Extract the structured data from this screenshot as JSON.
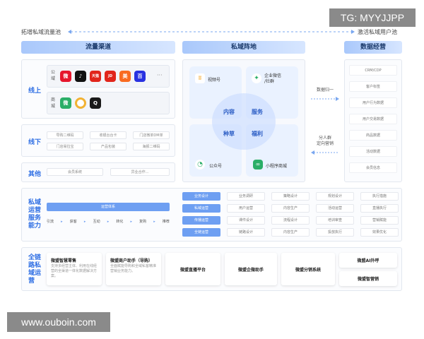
{
  "watermarks": {
    "top": "TG: MYYJJPP",
    "bottom": "www.ouboin.com"
  },
  "top_axis": {
    "left": "拓增私域流量池",
    "right": "激活私域用户池"
  },
  "headers": {
    "channels": "流量渠道",
    "private_domain": "私域阵地",
    "operations": "数据经营"
  },
  "online": {
    "label": "线上",
    "public_domain_label": [
      "公",
      "域"
    ],
    "mall_label": [
      "商",
      "城"
    ],
    "public_apps": [
      {
        "name": "weibo-icon",
        "glyph": "微",
        "color": "#e6162d"
      },
      {
        "name": "douyin-icon",
        "glyph": "♪",
        "color": "#111111"
      },
      {
        "name": "tmall-icon",
        "glyph": "天猫",
        "color": "#e1251b"
      },
      {
        "name": "jd-icon",
        "glyph": "JD",
        "color": "#e1251b"
      },
      {
        "name": "meituan-icon",
        "glyph": "美",
        "color": "#f96b21"
      },
      {
        "name": "baidu-icon",
        "glyph": "百",
        "color": "#2932e1"
      }
    ],
    "more": "···",
    "mall_apps": [
      {
        "name": "wechat-icon",
        "glyph": "微",
        "color": "#2aae67"
      },
      {
        "name": "miniprogram-ring-icon",
        "glyph": "",
        "color": "#f2b233"
      },
      {
        "name": "qq-icon",
        "glyph": "Q",
        "color": "#1a1a1a"
      }
    ]
  },
  "offline": {
    "label": "线下",
    "items": [
      "导购二维码",
      "收银台台卡",
      "门店微单DM单",
      "门店易拉宝",
      "产品包装",
      "海报二维码"
    ]
  },
  "other": {
    "label": "其他",
    "items": [
      "会员系统",
      "异业合作..."
    ]
  },
  "private_domain": {
    "quads": [
      {
        "label": "视频号",
        "icon": "video-channel-icon",
        "color": "#f5a623"
      },
      {
        "label": "企业微信\n/社群",
        "icon": "wecom-icon",
        "color": "#2aae67"
      },
      {
        "label": "公众号",
        "icon": "official-account-icon",
        "color": "#2aae67"
      },
      {
        "label": "小程序商城",
        "icon": "mini-program-icon",
        "color": "#2aae67"
      }
    ],
    "center_words": [
      "内容",
      "服务",
      "种草",
      "福利"
    ]
  },
  "arrows": {
    "data_unify": "数据归一",
    "segmentation": "分人群\n定向营销"
  },
  "data_ops": {
    "items": [
      "CRM/CDP",
      "客户标签",
      "用户行为数据",
      "用户交易数据",
      "商品数据",
      "活动数据",
      "会员信息"
    ]
  },
  "operations": {
    "label": "私域\n运营\n服务\n能力",
    "system": "运营体系",
    "flow": [
      "引流",
      "获客",
      "互动",
      "转化",
      "复购",
      "推荐"
    ],
    "grid": [
      [
        "业务设计",
        "业务调研",
        "策略设计",
        "规划设计",
        "执行措施"
      ],
      [
        "私域运营",
        "用户运营",
        "内容生产",
        "活动运营",
        "直播执行"
      ],
      [
        "传播运营",
        "课件设计",
        "流程设计",
        "培训审查",
        "营销赋能"
      ],
      [
        "全链运营",
        "链路设计",
        "内容生产",
        "投放执行",
        "效果优化"
      ]
    ]
  },
  "bottom": {
    "label": "全链\n路私\n域运\n营",
    "cards": [
      {
        "title": "微盟智慧零售",
        "desc": "支持多经营主体、利用在线经营的全渠道一体化数据解决方案。"
      },
      {
        "title": "微盟商户助手（导购）",
        "desc": "全面赋能导购和全域私客精准营销业务能力。"
      },
      {
        "title": "微盟直播平台",
        "desc": ""
      },
      {
        "title": "微盟企微助手",
        "desc": ""
      },
      {
        "title": "微盟分销系统",
        "desc": ""
      }
    ],
    "stack": [
      "微盟AI外呼",
      "微盟智营销"
    ]
  }
}
